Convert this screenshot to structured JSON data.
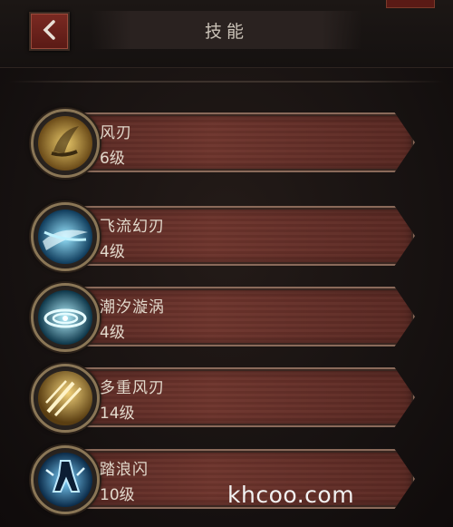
{
  "header": {
    "title": "技能"
  },
  "skills": [
    {
      "name": "风刃",
      "level": "6级",
      "icon": "wind-blade-icon",
      "color": "#c9a24a"
    },
    {
      "name": "飞流幻刃",
      "level": "4级",
      "icon": "flowing-blade-icon",
      "color": "#3aa6d8"
    },
    {
      "name": "潮汐漩涡",
      "level": "4级",
      "icon": "tidal-vortex-icon",
      "color": "#4ab8d6"
    },
    {
      "name": "多重风刃",
      "level": "14级",
      "icon": "multi-wind-blade-icon",
      "color": "#c9a24a"
    },
    {
      "name": "踏浪闪",
      "level": "10级",
      "icon": "wave-step-icon",
      "color": "#3a9ad8"
    }
  ],
  "watermark": "khcoo.com"
}
